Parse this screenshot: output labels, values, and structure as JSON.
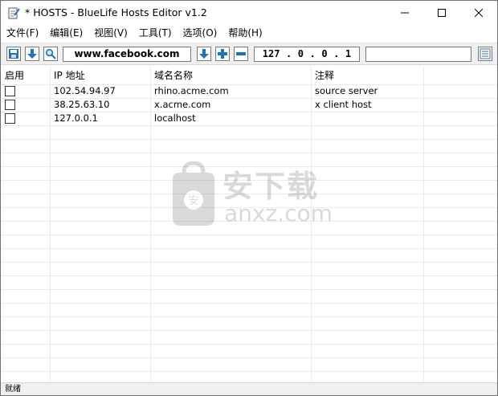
{
  "window": {
    "title": "* HOSTS - BlueLife Hosts Editor v1.2"
  },
  "menu": [
    {
      "label": "文件(F)"
    },
    {
      "label": "编辑(E)"
    },
    {
      "label": "视图(V)"
    },
    {
      "label": "工具(T)"
    },
    {
      "label": "选项(O)"
    },
    {
      "label": "帮助(H)"
    }
  ],
  "toolbar": {
    "domain_value": "www.facebook.com",
    "ip_octets": [
      "127",
      "0",
      "0",
      "1"
    ],
    "comment_value": ""
  },
  "table": {
    "columns": [
      "启用",
      "IP 地址",
      "域名名称",
      "注释"
    ],
    "rows": [
      {
        "enabled": false,
        "ip": "102.54.94.97",
        "domain": "rhino.acme.com",
        "comment": "source server"
      },
      {
        "enabled": false,
        "ip": "38.25.63.10",
        "domain": "x.acme.com",
        "comment": "x client host"
      },
      {
        "enabled": false,
        "ip": "127.0.0.1",
        "domain": "localhost",
        "comment": ""
      }
    ]
  },
  "watermark": {
    "text_cn": "安下载",
    "text_en": "anxz.com"
  },
  "status": {
    "text": "就绪"
  },
  "colors": {
    "icon_blue": "#1e73be",
    "accent_blue": "#3c8fd8"
  }
}
